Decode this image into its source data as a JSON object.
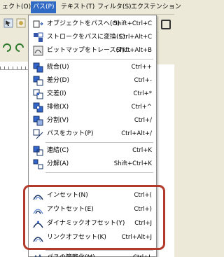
{
  "menubar": {
    "items": [
      {
        "label": "ェクト(O)"
      },
      {
        "label": "パス(P)"
      },
      {
        "label": "テキスト(T)"
      },
      {
        "label": "フィルタ(S)"
      },
      {
        "label": "エクステンション"
      }
    ]
  },
  "menu": {
    "items": [
      {
        "label": "オブジェクトをパスへ(O)",
        "shortcut": "Shift+Ctrl+C",
        "icon": "object-to-path-icon"
      },
      {
        "label": "ストロークをパスに変換(S)",
        "shortcut": "Ctrl+Alt+C",
        "icon": "stroke-to-path-icon"
      },
      {
        "label": "ビットマップをトレース(T)...",
        "shortcut": "Shift+Alt+B",
        "icon": "trace-bitmap-icon"
      },
      {
        "label": "統合(U)",
        "shortcut": "Ctrl++",
        "icon": "union-icon"
      },
      {
        "label": "差分(D)",
        "shortcut": "Ctrl+-",
        "icon": "difference-icon"
      },
      {
        "label": "交差(I)",
        "shortcut": "Ctrl+*",
        "icon": "intersection-icon"
      },
      {
        "label": "排他(X)",
        "shortcut": "Ctrl+^",
        "icon": "exclusion-icon"
      },
      {
        "label": "分割(V)",
        "shortcut": "Ctrl+/",
        "icon": "division-icon"
      },
      {
        "label": "パスをカット(P)",
        "shortcut": "Ctrl+Alt+/",
        "icon": "cut-path-icon"
      },
      {
        "label": "連結(C)",
        "shortcut": "Ctrl+K",
        "icon": "combine-icon"
      },
      {
        "label": "分解(A)",
        "shortcut": "Shift+Ctrl+K",
        "icon": "break-apart-icon"
      },
      {
        "label": "インセット(N)",
        "shortcut": "Ctrl+(",
        "icon": "inset-icon"
      },
      {
        "label": "アウトセット(E)",
        "shortcut": "Ctrl+)",
        "icon": "outset-icon"
      },
      {
        "label": "ダイナミックオフセット(Y)",
        "shortcut": "Ctrl+J",
        "icon": "dynamic-offset-icon"
      },
      {
        "label": "リンクオフセット(K)",
        "shortcut": "Ctrl+Alt+J",
        "icon": "linked-offset-icon"
      },
      {
        "label": "パスの簡略化(M)",
        "shortcut": "Ctrl+L",
        "icon": "simplify-icon"
      }
    ]
  }
}
